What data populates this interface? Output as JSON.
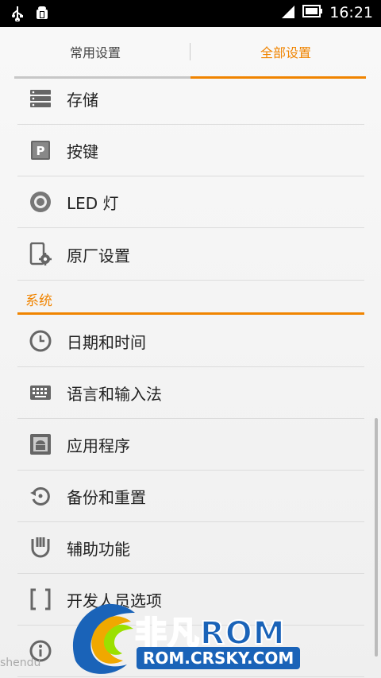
{
  "status_bar": {
    "time": "16:21"
  },
  "tabs": [
    {
      "label": "常用设置"
    },
    {
      "label": "全部设置"
    }
  ],
  "items_top": [
    {
      "label": "存储",
      "icon": "storage-icon"
    },
    {
      "label": "按键",
      "icon": "key-icon"
    },
    {
      "label": "LED 灯",
      "icon": "led-icon"
    },
    {
      "label": "原厂设置",
      "icon": "factory-settings-icon"
    }
  ],
  "section_system": {
    "label": "系统"
  },
  "items_system": [
    {
      "label": "日期和时间",
      "icon": "clock-icon"
    },
    {
      "label": "语言和输入法",
      "icon": "keyboard-icon"
    },
    {
      "label": "应用程序",
      "icon": "android-app-icon"
    },
    {
      "label": "备份和重置",
      "icon": "backup-icon"
    },
    {
      "label": "辅助功能",
      "icon": "hand-icon"
    },
    {
      "label": "开发人员选项",
      "icon": "brackets-icon"
    }
  ],
  "watermark": {
    "brand": "非凡ROM",
    "url": "ROM.CRSKY.COM",
    "left_mark": "shendu"
  },
  "colors": {
    "accent": "#f08400",
    "text": "#222222",
    "background": "#f4f4f4"
  }
}
